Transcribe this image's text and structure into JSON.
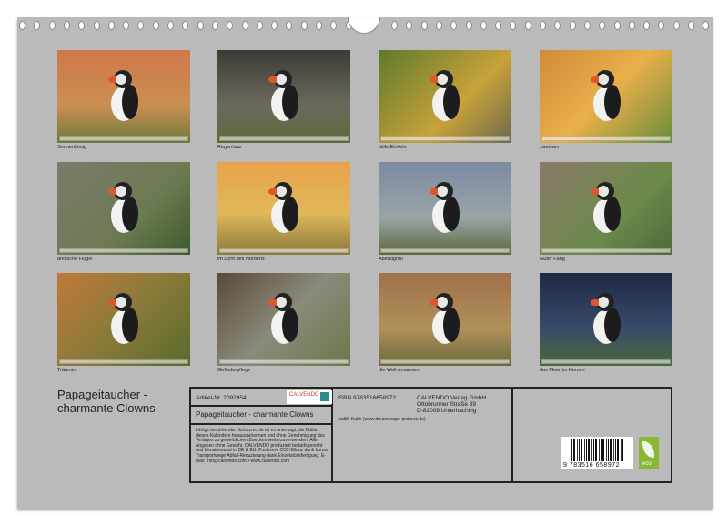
{
  "photos": [
    {
      "caption": "Sonnenkönig",
      "bg": "linear-gradient(180deg,#d0784a,#c98f52 60%,#6e7a3a)"
    },
    {
      "caption": "Regentanz",
      "bg": "linear-gradient(180deg,#3d3b36,#6b6a5c 60%,#5c6a3a)"
    },
    {
      "caption": "stille Einkehr",
      "bg": "linear-gradient(135deg,#5e7a2c,#c8a23a 60%,#6c6a4c)"
    },
    {
      "caption": "zweisam",
      "bg": "linear-gradient(135deg,#d08a3a,#e8b04a 50%,#6a8a3a)"
    },
    {
      "caption": "arktische Flügel",
      "bg": "linear-gradient(135deg,#7a7c6a,#6c7a52 60%,#3e5a2a)"
    },
    {
      "caption": "im Licht des Nordens",
      "bg": "linear-gradient(180deg,#e8a24a,#e0b85a 55%,#8a7a3a)"
    },
    {
      "caption": "Abendgruß",
      "bg": "linear-gradient(180deg,#7a8aa0,#9aa4a8 60%,#5a6a3a)"
    },
    {
      "caption": "Guter Fang",
      "bg": "linear-gradient(135deg,#8a7a6a,#6c8a4a 60%,#4e6a3a)"
    },
    {
      "caption": "Träumer",
      "bg": "linear-gradient(135deg,#c07a3a,#8a7a3a 50%,#5a6a2a)"
    },
    {
      "caption": "Gefiederpflege",
      "bg": "linear-gradient(135deg,#5a4a3a,#8a8a7a 50%,#6a7a4a)"
    },
    {
      "caption": "die Welt umarmen",
      "bg": "linear-gradient(180deg,#a0704a,#b0905a 60%,#6a6a3a)"
    },
    {
      "caption": "das Meer im Herzen",
      "bg": "linear-gradient(180deg,#1e2a44,#3a4a6a 60%,#4a6a3a)"
    }
  ],
  "title_line1": "Papageitaucher -",
  "title_line2": "charmante Clowns",
  "info": {
    "article": "Artikel-Nr. 2092954",
    "logo": "CALVENDO",
    "product_title": "Papageitaucher - charmante Clowns",
    "legal": "Infolge bestehender Schutzrechte ist es untersagt, die Blätter dieses Kalenders herauszutrennen und ohne Genehmigung des Verlages zu gewerblichen Zwecken weiterzuverwenden. Alle Angaben ohne Gewähr. CALVENDO produziert bedarfsgerecht und klimabewusst in DE & EU. Positivere CO2-Bilanz dank kurzer Transportwege Abfall-Reduzierung dank Einzelstückfertigung. E-Mail: info@calvendo.com • www.calvendo.com",
    "isbn": "ISBN 9783516658972",
    "publisher1": "CALVENDO Verlag GmbH",
    "publisher2": "Ottobrunner Straße 39",
    "publisher3": "D-82008 Unterhaching",
    "author": "Judith Kuhn (www.dreamscape-pictures.de)",
    "barcode_number": "9 783516 658972",
    "eco_label": "eco"
  }
}
